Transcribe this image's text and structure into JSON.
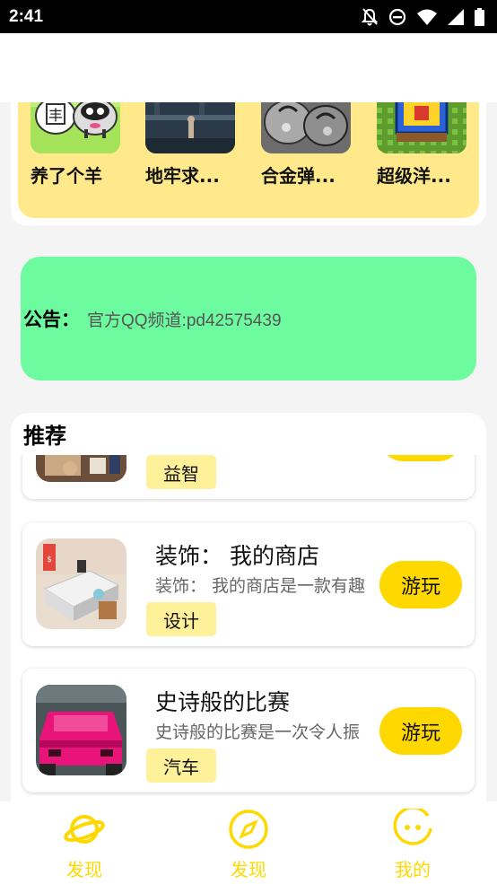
{
  "status_bar": {
    "time": "2:41",
    "icons": [
      "notifications-off-icon",
      "do-not-disturb-icon",
      "wifi-icon",
      "signal-icon",
      "battery-icon"
    ]
  },
  "games": [
    {
      "name": "养了个羊",
      "icon": "sheep-game-thumbnail"
    },
    {
      "name": "地牢求...",
      "icon": "dungeon-game-thumbnail"
    },
    {
      "name": "合金弹...",
      "icon": "metal-slug-thumbnail"
    },
    {
      "name": "超级洋...",
      "icon": "pixel-game-thumbnail"
    }
  ],
  "notice": {
    "label": "公告：",
    "text": "官方QQ频道:pd42575439"
  },
  "recommend": {
    "title": "推荐",
    "apps": [
      {
        "title": "",
        "desc": "",
        "tag": "益智",
        "button": ""
      },
      {
        "title": "装饰： 我的商店",
        "desc": "装饰： 我的商店是一款有趣",
        "tag": "设计",
        "button": "游玩"
      },
      {
        "title": "史诗般的比赛",
        "desc": "史诗般的比赛是一次令人振",
        "tag": "汽车",
        "button": "游玩"
      }
    ]
  },
  "bottom_nav": [
    {
      "label": "发现",
      "icon": "planet-icon"
    },
    {
      "label": "发现",
      "icon": "compass-icon"
    },
    {
      "label": "我的",
      "icon": "smiley-face-icon"
    }
  ],
  "colors": {
    "accent_yellow": "#ffd800",
    "games_bg": "#ffe98a",
    "notice_bg": "#6dfba0",
    "tag_bg": "#fff19a"
  }
}
